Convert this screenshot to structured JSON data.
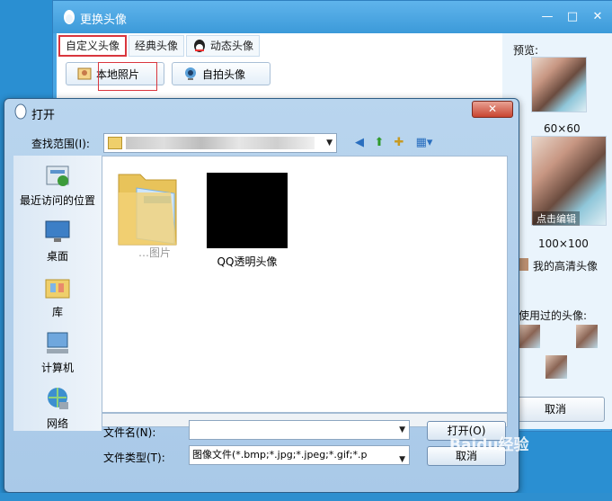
{
  "qq_window": {
    "title": "更换头像",
    "controls": {
      "minimize": "—",
      "maximize": "□",
      "close": "✕"
    },
    "tabs": [
      {
        "label": "自定义头像",
        "active": true
      },
      {
        "label": "经典头像",
        "active": false
      },
      {
        "label": "动态头像",
        "active": false
      }
    ],
    "buttons": {
      "local_photo": "本地照片",
      "selfie": "自拍头像"
    },
    "right_panel": {
      "preview_label": "预览:",
      "size_small": "60×60",
      "size_large": "100×100",
      "edit_hint": "点击编辑",
      "hd_avatar": "我的高清头像",
      "used_avatars": "我使用过的头像:"
    },
    "cancel": "取消"
  },
  "open_dialog": {
    "title": "打开",
    "close_label": "✕",
    "look_in_label": "查找范围(I):",
    "places": [
      {
        "label": "最近访问的位置",
        "icon": "recent-places-icon"
      },
      {
        "label": "桌面",
        "icon": "desktop-icon"
      },
      {
        "label": "库",
        "icon": "libraries-icon"
      },
      {
        "label": "计算机",
        "icon": "computer-icon"
      },
      {
        "label": "网络",
        "icon": "network-icon"
      }
    ],
    "files": [
      {
        "name": "…图片",
        "kind": "folder"
      },
      {
        "name": "QQ透明头像",
        "kind": "image"
      }
    ],
    "filename_label": "文件名(N):",
    "filename_value": "",
    "filetype_label": "文件类型(T):",
    "filetype_value": "图像文件(*.bmp;*.jpg;*.jpeg;*.gif;*.p",
    "open_button": "打开(O)",
    "cancel_button": "取消"
  },
  "watermark": "Baidu经验"
}
